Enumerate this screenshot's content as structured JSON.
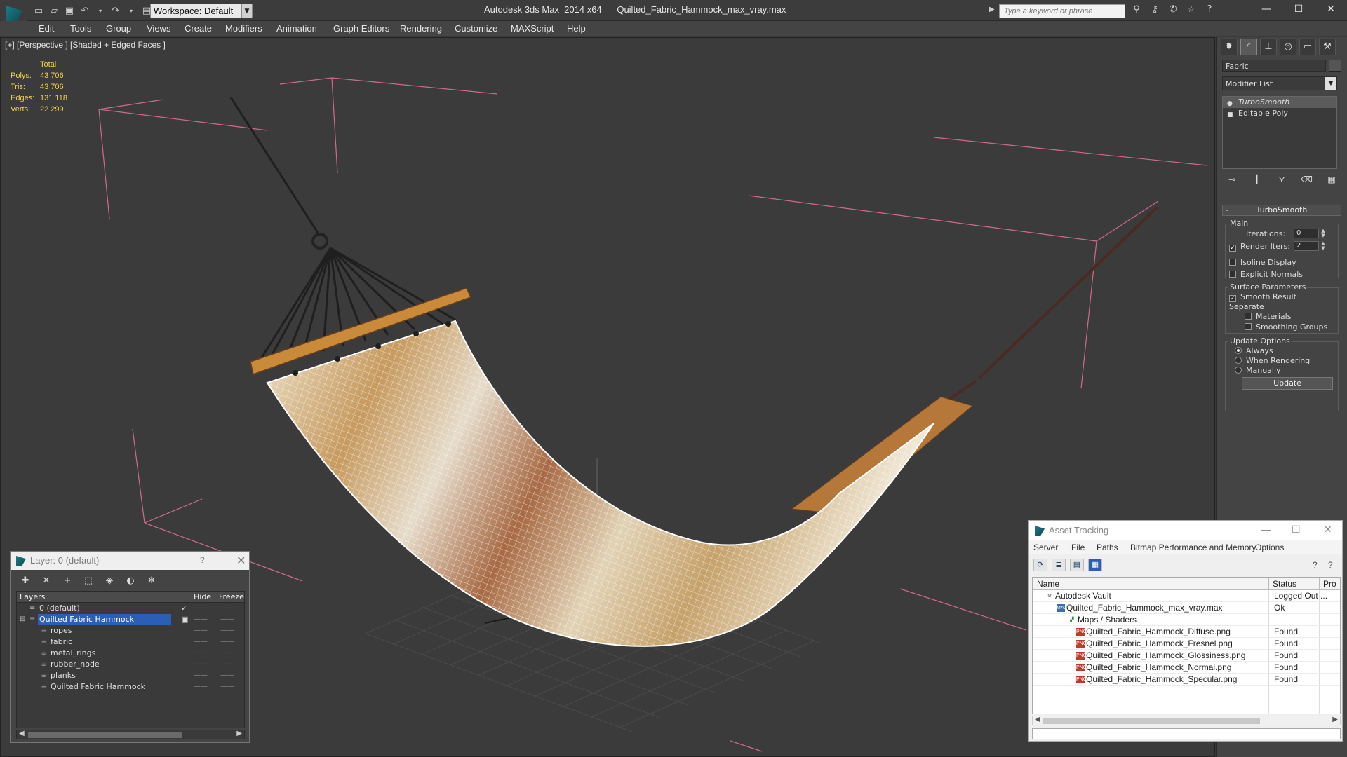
{
  "titlebar": {
    "workspace_label": "Workspace: Default",
    "window_title": "Autodesk 3ds Max  2014 x64      Quilted_Fabric_Hammock_max_vray.max",
    "search_placeholder": "Type a keyword or phrase"
  },
  "menu": [
    "Edit",
    "Tools",
    "Group",
    "Views",
    "Create",
    "Modifiers",
    "Animation",
    "Graph Editors",
    "Rendering",
    "Customize",
    "MAXScript",
    "Help"
  ],
  "viewport": {
    "label": "[+] [Perspective ] [Shaded + Edged Faces ]",
    "stats_header": "Total",
    "stats": [
      {
        "label": "Polys:",
        "value": "43 706"
      },
      {
        "label": "Tris:",
        "value": "43 706"
      },
      {
        "label": "Edges:",
        "value": "131 118"
      },
      {
        "label": "Verts:",
        "value": "22 299"
      }
    ],
    "colors": {
      "bracket": "#d06a8c",
      "rope": "#2a2a2a",
      "plank": "#c98a3a",
      "fabric": "#d9c9a8",
      "wire": "#ffffff"
    }
  },
  "command_panel": {
    "object_name": "Fabric",
    "modifier_list": "Modifier List",
    "stack": [
      {
        "label": "TurboSmooth",
        "selected": true
      },
      {
        "label": "Editable Poly",
        "selected": false
      }
    ],
    "rollout_title": "TurboSmooth",
    "main_group": "Main",
    "iterations_label": "Iterations:",
    "iterations_value": "0",
    "render_iters_label": "Render Iters:",
    "render_iters_value": "2",
    "isoline_label": "Isoline Display",
    "explicit_normals_label": "Explicit Normals",
    "surface_group": "Surface Parameters",
    "smooth_result_label": "Smooth Result",
    "separate_label": "Separate",
    "materials_label": "Materials",
    "smoothing_groups_label": "Smoothing Groups",
    "update_group": "Update Options",
    "always_label": "Always",
    "when_rendering_label": "When Rendering",
    "manually_label": "Manually",
    "update_button": "Update"
  },
  "layer_window": {
    "title": "Layer: 0 (default)",
    "help": "?",
    "col_layers": "Layers",
    "col_hide": "Hide",
    "col_freeze": "Freeze",
    "rows": [
      {
        "name": "0 (default)",
        "level": 0,
        "selected": false
      },
      {
        "name": "Quilted Fabric Hammock",
        "level": 0,
        "selected": true
      },
      {
        "name": "ropes",
        "level": 1,
        "selected": false
      },
      {
        "name": "fabric",
        "level": 1,
        "selected": false
      },
      {
        "name": "metal_rings",
        "level": 1,
        "selected": false
      },
      {
        "name": "rubber_node",
        "level": 1,
        "selected": false
      },
      {
        "name": "planks",
        "level": 1,
        "selected": false
      },
      {
        "name": "Quilted Fabric Hammock",
        "level": 1,
        "selected": false
      }
    ]
  },
  "asset_window": {
    "title": "Asset Tracking",
    "menu": [
      "Server",
      "File",
      "Paths",
      "Bitmap Performance and Memory",
      "Options"
    ],
    "col_name": "Name",
    "col_status": "Status",
    "col_pro": "Pro",
    "rows": [
      {
        "name": "Autodesk Vault",
        "status": "Logged Out ...",
        "level": 0,
        "type": "vault"
      },
      {
        "name": "Quilted_Fabric_Hammock_max_vray.max",
        "status": "Ok",
        "level": 1,
        "type": "max"
      },
      {
        "name": "Maps / Shaders",
        "status": "",
        "level": 2,
        "type": "maps"
      },
      {
        "name": "Quilted_Fabric_Hammock_Diffuse.png",
        "status": "Found",
        "level": 3,
        "type": "png"
      },
      {
        "name": "Quilted_Fabric_Hammock_Fresnel.png",
        "status": "Found",
        "level": 3,
        "type": "png"
      },
      {
        "name": "Quilted_Fabric_Hammock_Glossiness.png",
        "status": "Found",
        "level": 3,
        "type": "png"
      },
      {
        "name": "Quilted_Fabric_Hammock_Normal.png",
        "status": "Found",
        "level": 3,
        "type": "png"
      },
      {
        "name": "Quilted_Fabric_Hammock_Specular.png",
        "status": "Found",
        "level": 3,
        "type": "png"
      }
    ]
  }
}
